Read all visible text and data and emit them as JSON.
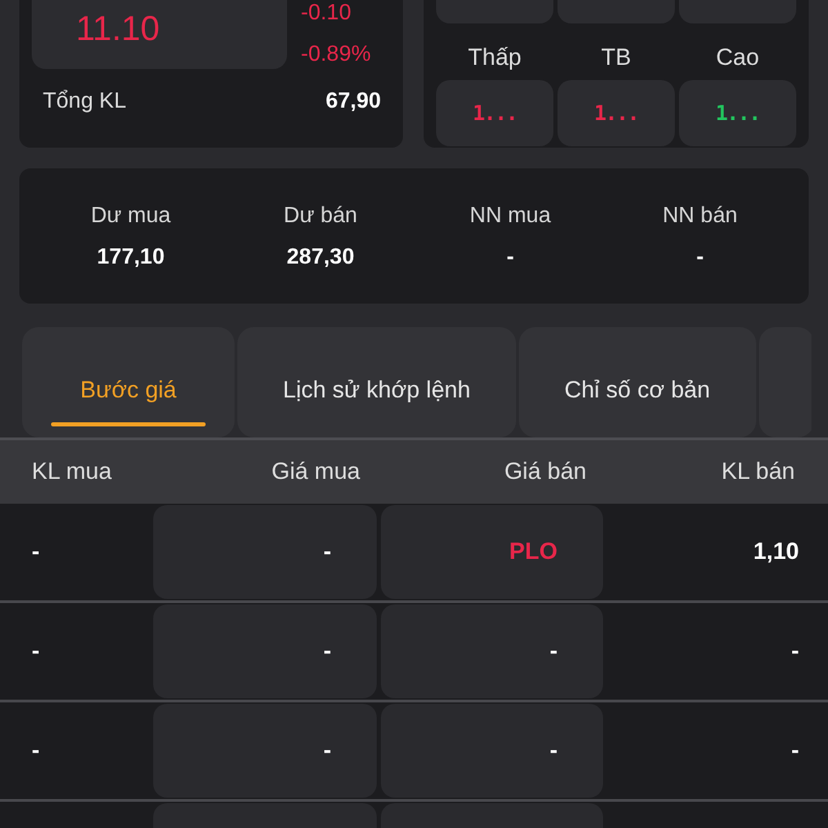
{
  "quote": {
    "price": "11.10",
    "change": "-0.10",
    "change_percent": "-0.89%",
    "total_volume_label": "Tổng KL",
    "total_volume": "67,90"
  },
  "range": [
    {
      "label": "Thấp",
      "value": "1...",
      "color": "#e8264a"
    },
    {
      "label": "TB",
      "value": "1...",
      "color": "#e8264a"
    },
    {
      "label": "Cao",
      "value": "1...",
      "color": "#22c55e"
    }
  ],
  "order_summary": [
    {
      "label": "Dư mua",
      "value": "177,10"
    },
    {
      "label": "Dư bán",
      "value": "287,30"
    },
    {
      "label": "NN mua",
      "value": "-"
    },
    {
      "label": "NN bán",
      "value": "-"
    }
  ],
  "tabs": [
    {
      "label": "Bước giá",
      "selected": true
    },
    {
      "label": "Lịch sử khớp lệnh",
      "selected": false
    },
    {
      "label": "Chỉ số cơ bản",
      "selected": false
    }
  ],
  "table": {
    "columns": [
      "KL mua",
      "Giá mua",
      "Giá bán",
      "KL bán"
    ],
    "rows": [
      {
        "cells": [
          {
            "text": "-"
          },
          {
            "text": "-"
          },
          {
            "text": "PLO",
            "color": "#e8264a"
          },
          {
            "text": "1,10"
          }
        ]
      },
      {
        "cells": [
          {
            "text": "-"
          },
          {
            "text": "-"
          },
          {
            "text": "-"
          },
          {
            "text": "-"
          }
        ]
      },
      {
        "cells": [
          {
            "text": "-"
          },
          {
            "text": "-"
          },
          {
            "text": "-"
          },
          {
            "text": "-"
          }
        ]
      }
    ]
  }
}
